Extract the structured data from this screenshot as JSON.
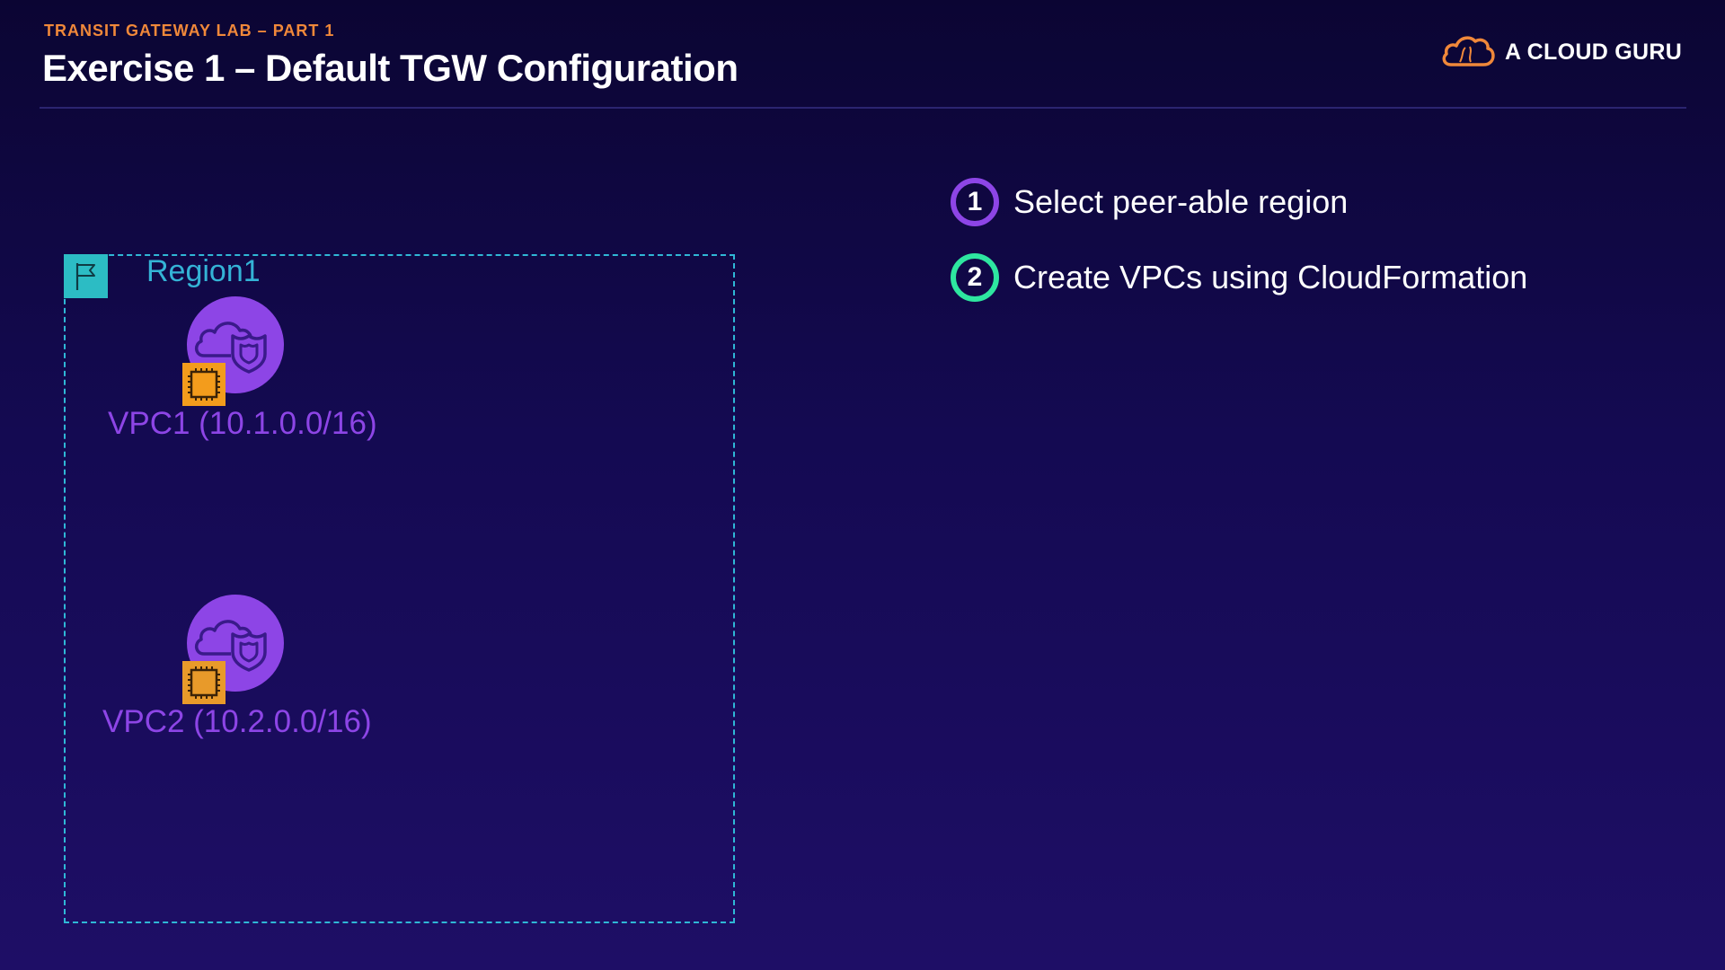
{
  "header": {
    "eyebrow": "TRANSIT GATEWAY LAB – PART 1",
    "title": "Exercise 1 – Default TGW Configuration"
  },
  "brand": {
    "name": "A CLOUD GURU",
    "icon": "cloud-logo-icon",
    "accent": "#f0883a"
  },
  "diagram": {
    "region": {
      "label": "Region1",
      "icon": "flag-icon",
      "border_color": "#2fb8d6",
      "fill_color": "#2cbcc4"
    },
    "vpcs": [
      {
        "label": "VPC1 (10.1.0.0/16)",
        "icon": "vpc-cloud-shield-icon",
        "badge_icon": "ec2-chip-icon"
      },
      {
        "label": "VPC2 (10.2.0.0/16)",
        "icon": "vpc-cloud-shield-icon",
        "badge_icon": "ec2-chip-icon"
      }
    ],
    "colors": {
      "vpc": "#8d45e6",
      "chip": "#f39c1c"
    }
  },
  "steps": [
    {
      "number": "1",
      "text": "Select peer-able region",
      "color": "#8d45e6"
    },
    {
      "number": "2",
      "text": "Create VPCs using CloudFormation",
      "color": "#2ee6a0"
    }
  ]
}
